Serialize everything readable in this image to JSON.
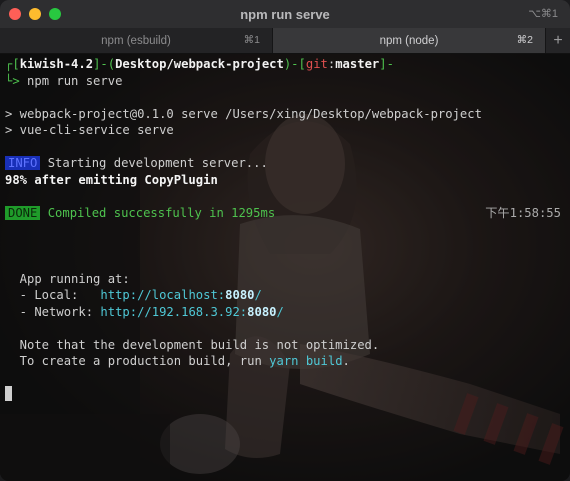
{
  "window": {
    "title": "npm run serve",
    "shortcut": "⌥⌘1"
  },
  "tabs": [
    {
      "label": "npm (esbuild)",
      "key": "⌘1",
      "active": false
    },
    {
      "label": "npm (node)",
      "key": "⌘2",
      "active": true
    }
  ],
  "newtab_label": "+",
  "prompt": {
    "open_bracket": "┌[",
    "user": "kiwish-4.2",
    "sep1": "]-(",
    "path": "Desktop/webpack-project",
    "sep2": ")-[",
    "git_label": "git",
    "git_colon": ":",
    "branch": "master",
    "close": "]-",
    "arrow": "└>",
    "command": " npm run serve"
  },
  "output": {
    "line1": "> webpack-project@0.1.0 serve /Users/xing/Desktop/webpack-project",
    "line2": "> vue-cli-service serve",
    "info_badge": "INFO",
    "info_text": " Starting development server...",
    "progress": "98% after emitting CopyPlugin",
    "done_badge": "DONE",
    "done_text": " Compiled successfully in 1295ms",
    "timestamp": "下午1:58:55",
    "app_running": "  App running at:",
    "local_label": "  - Local:   ",
    "local_url_prefix": "http://localhost:",
    "local_port": "8080",
    "local_url_suffix": "/",
    "network_label": "  - Network: ",
    "network_url_prefix": "http://192.168.3.92:",
    "network_port": "8080",
    "network_url_suffix": "/",
    "note1": "  Note that the development build is not optimized.",
    "note2_prefix": "  To create a production build, run ",
    "note2_cmd": "yarn build",
    "note2_suffix": "."
  },
  "colors": {
    "info_bg": "#1930b8",
    "done_bg": "#1f9b2a",
    "prompt_green": "#4ec24e",
    "prompt_red": "#e05050",
    "url_cyan": "#4fc8d6"
  }
}
